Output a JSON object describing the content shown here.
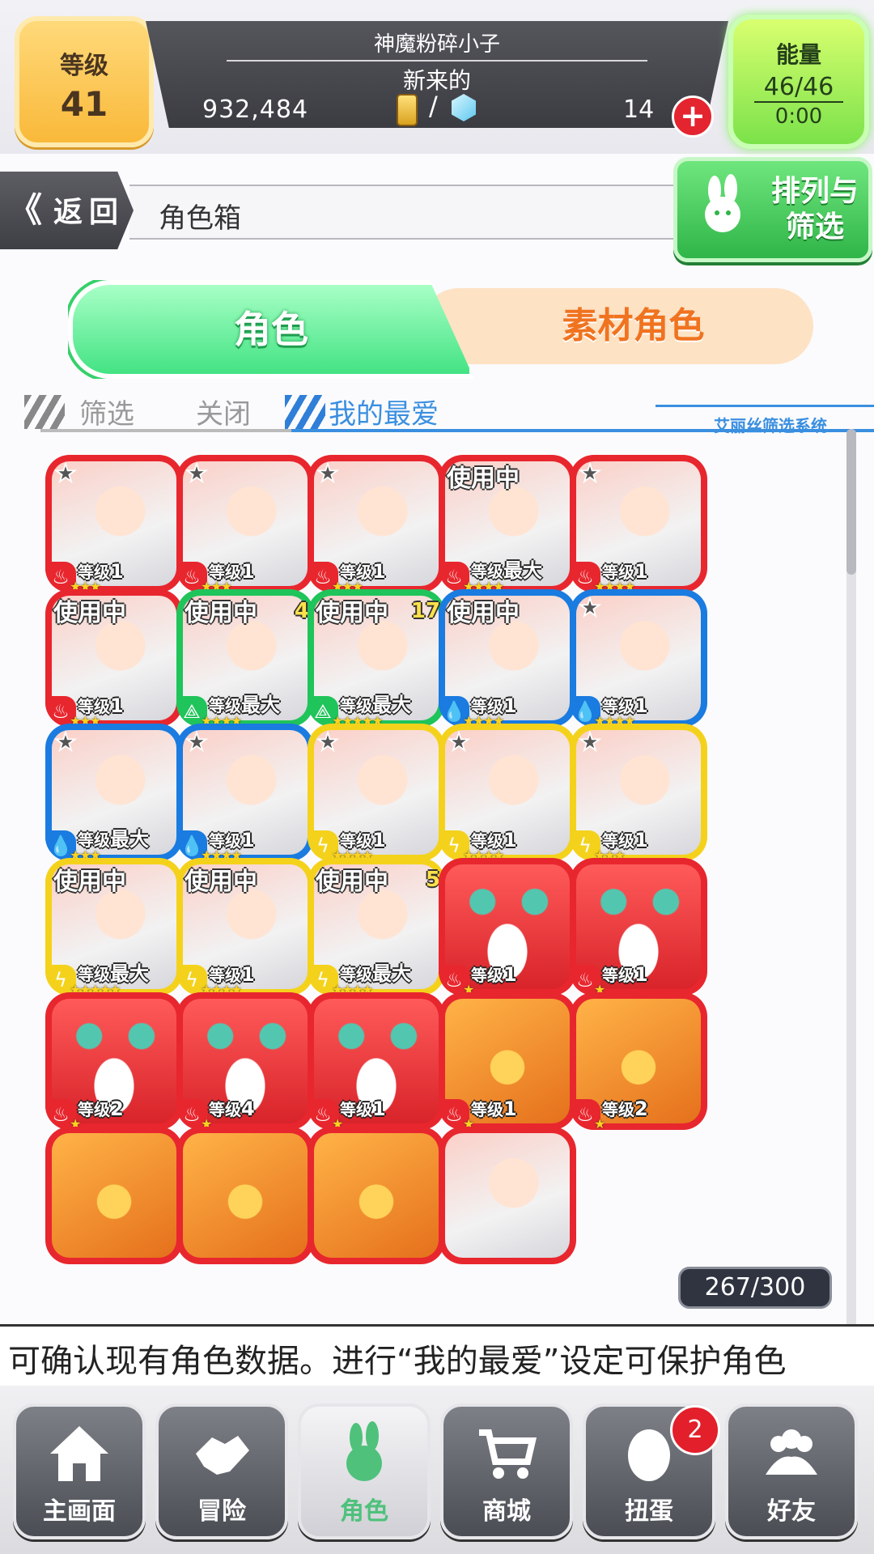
{
  "header": {
    "level_label": "等级",
    "level_value": "41",
    "player_name": "神魔粉碎小子",
    "player_title": "新来的",
    "coins": "932,484",
    "gems": "14",
    "slash": "/",
    "add_label": "+",
    "energy_label": "能量",
    "energy_value": "46/46",
    "energy_timer": "0:00"
  },
  "subheader": {
    "back_chevron": "《",
    "back_label": "返回",
    "title": "角色箱",
    "sort_label": "排列与筛选"
  },
  "tabs": {
    "character": "角色",
    "material": "素材角色"
  },
  "filters": {
    "filter": "筛选",
    "close": "关闭",
    "favorites": "我的最爱",
    "system_label": "艾丽丝筛选系统"
  },
  "cards": [
    {
      "color": "#e8262e",
      "element": "♨",
      "fav": true,
      "in_use": false,
      "extra": "",
      "level": "1",
      "stars": "★★★",
      "art": "girl"
    },
    {
      "color": "#e8262e",
      "element": "♨",
      "fav": true,
      "in_use": false,
      "extra": "",
      "level": "1",
      "stars": "★★★",
      "art": "girl"
    },
    {
      "color": "#e8262e",
      "element": "♨",
      "fav": true,
      "in_use": false,
      "extra": "",
      "level": "1",
      "stars": "★★★",
      "art": "girl"
    },
    {
      "color": "#e8262e",
      "element": "♨",
      "fav": false,
      "in_use": true,
      "extra": "",
      "level": "最大",
      "stars": "★★★★",
      "art": "girl"
    },
    {
      "color": "#e8262e",
      "element": "♨",
      "fav": true,
      "in_use": false,
      "extra": "",
      "level": "1",
      "stars": "★★★★",
      "art": "girl"
    },
    {
      "color": "#e8262e",
      "element": "♨",
      "fav": false,
      "in_use": true,
      "extra": "",
      "level": "1",
      "stars": "★★★",
      "art": "girl"
    },
    {
      "color": "#1fc45a",
      "element": "⟁",
      "fav": false,
      "in_use": true,
      "extra": "4",
      "level": "最大",
      "stars": "★★★★",
      "art": "girl"
    },
    {
      "color": "#1fc45a",
      "element": "⟁",
      "fav": false,
      "in_use": true,
      "extra": "17",
      "level": "最大",
      "stars": "★★★★★",
      "art": "girl"
    },
    {
      "color": "#1a7be0",
      "element": "💧",
      "fav": false,
      "in_use": true,
      "extra": "",
      "level": "1",
      "stars": "★★★★",
      "art": "girl"
    },
    {
      "color": "#1a7be0",
      "element": "💧",
      "fav": true,
      "in_use": false,
      "extra": "",
      "level": "1",
      "stars": "★★★★",
      "art": "girl"
    },
    {
      "color": "#1a7be0",
      "element": "💧",
      "fav": true,
      "in_use": false,
      "extra": "",
      "level": "最大",
      "stars": "★★★",
      "art": "girl"
    },
    {
      "color": "#1a7be0",
      "element": "💧",
      "fav": true,
      "in_use": false,
      "extra": "",
      "level": "1",
      "stars": "★★★★",
      "art": "girl"
    },
    {
      "color": "#f4d21c",
      "element": "ϟ",
      "fav": true,
      "in_use": false,
      "extra": "",
      "level": "1",
      "stars": "★★★★",
      "art": "girl"
    },
    {
      "color": "#f4d21c",
      "element": "ϟ",
      "fav": true,
      "in_use": false,
      "extra": "",
      "level": "1",
      "stars": "★★★★",
      "art": "girl"
    },
    {
      "color": "#f4d21c",
      "element": "ϟ",
      "fav": true,
      "in_use": false,
      "extra": "",
      "level": "1",
      "stars": "★★★",
      "art": "girl"
    },
    {
      "color": "#f4d21c",
      "element": "ϟ",
      "fav": false,
      "in_use": true,
      "extra": "",
      "level": "最大",
      "stars": "★★★★★",
      "art": "girl"
    },
    {
      "color": "#f4d21c",
      "element": "ϟ",
      "fav": false,
      "in_use": true,
      "extra": "",
      "level": "1",
      "stars": "★★★★",
      "art": "girl"
    },
    {
      "color": "#f4d21c",
      "element": "ϟ",
      "fav": false,
      "in_use": true,
      "extra": "5",
      "level": "最大",
      "stars": "★★★★",
      "art": "girl"
    },
    {
      "color": "#e8262e",
      "element": "♨",
      "fav": false,
      "in_use": false,
      "extra": "",
      "level": "1",
      "stars": "★",
      "art": "mascot"
    },
    {
      "color": "#e8262e",
      "element": "♨",
      "fav": false,
      "in_use": false,
      "extra": "",
      "level": "1",
      "stars": "★",
      "art": "mascot"
    },
    {
      "color": "#e8262e",
      "element": "♨",
      "fav": false,
      "in_use": false,
      "extra": "",
      "level": "2",
      "stars": "★",
      "art": "mascot"
    },
    {
      "color": "#e8262e",
      "element": "♨",
      "fav": false,
      "in_use": false,
      "extra": "",
      "level": "4",
      "stars": "★",
      "art": "mascot"
    },
    {
      "color": "#e8262e",
      "element": "♨",
      "fav": false,
      "in_use": false,
      "extra": "",
      "level": "1",
      "stars": "★",
      "art": "mascot"
    },
    {
      "color": "#e8262e",
      "element": "♨",
      "fav": false,
      "in_use": false,
      "extra": "",
      "level": "1",
      "stars": "★",
      "art": "bird"
    },
    {
      "color": "#e8262e",
      "element": "♨",
      "fav": false,
      "in_use": false,
      "extra": "",
      "level": "2",
      "stars": "★",
      "art": "bird"
    },
    {
      "color": "#e8262e",
      "element": "♨",
      "fav": false,
      "in_use": false,
      "extra": "",
      "level": "",
      "stars": "",
      "art": "bird"
    },
    {
      "color": "#e8262e",
      "element": "♨",
      "fav": false,
      "in_use": false,
      "extra": "",
      "level": "",
      "stars": "",
      "art": "bird"
    },
    {
      "color": "#e8262e",
      "element": "♨",
      "fav": false,
      "in_use": false,
      "extra": "",
      "level": "",
      "stars": "",
      "art": "bird"
    },
    {
      "color": "#e8262e",
      "element": "♨",
      "fav": false,
      "in_use": false,
      "extra": "",
      "level": "",
      "stars": "",
      "art": "girl"
    }
  ],
  "card_labels": {
    "in_use": "使用中",
    "level_prefix": "等级"
  },
  "count": "267/300",
  "message": "可确认现有角色数据。进行“我的最爱”设定可保护角色",
  "nav": {
    "home": "主画面",
    "adventure": "冒险",
    "character": "角色",
    "shop": "商城",
    "gacha": "扭蛋",
    "friends": "好友",
    "gacha_badge": "2"
  }
}
